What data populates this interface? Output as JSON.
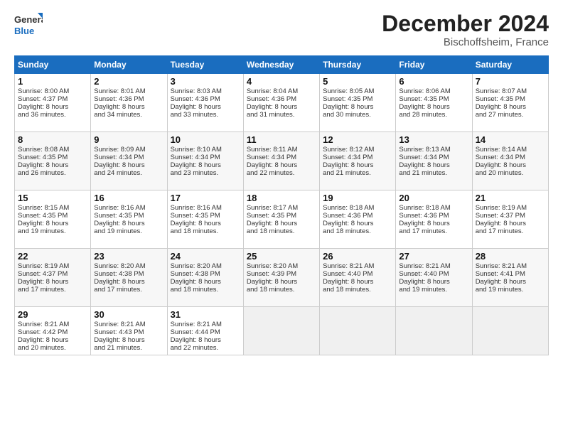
{
  "header": {
    "logo_line1": "General",
    "logo_line2": "Blue",
    "month": "December 2024",
    "location": "Bischoffsheim, France"
  },
  "days_of_week": [
    "Sunday",
    "Monday",
    "Tuesday",
    "Wednesday",
    "Thursday",
    "Friday",
    "Saturday"
  ],
  "weeks": [
    [
      {
        "day": "1",
        "lines": [
          "Sunrise: 8:00 AM",
          "Sunset: 4:37 PM",
          "Daylight: 8 hours",
          "and 36 minutes."
        ]
      },
      {
        "day": "2",
        "lines": [
          "Sunrise: 8:01 AM",
          "Sunset: 4:36 PM",
          "Daylight: 8 hours",
          "and 34 minutes."
        ]
      },
      {
        "day": "3",
        "lines": [
          "Sunrise: 8:03 AM",
          "Sunset: 4:36 PM",
          "Daylight: 8 hours",
          "and 33 minutes."
        ]
      },
      {
        "day": "4",
        "lines": [
          "Sunrise: 8:04 AM",
          "Sunset: 4:36 PM",
          "Daylight: 8 hours",
          "and 31 minutes."
        ]
      },
      {
        "day": "5",
        "lines": [
          "Sunrise: 8:05 AM",
          "Sunset: 4:35 PM",
          "Daylight: 8 hours",
          "and 30 minutes."
        ]
      },
      {
        "day": "6",
        "lines": [
          "Sunrise: 8:06 AM",
          "Sunset: 4:35 PM",
          "Daylight: 8 hours",
          "and 28 minutes."
        ]
      },
      {
        "day": "7",
        "lines": [
          "Sunrise: 8:07 AM",
          "Sunset: 4:35 PM",
          "Daylight: 8 hours",
          "and 27 minutes."
        ]
      }
    ],
    [
      {
        "day": "8",
        "lines": [
          "Sunrise: 8:08 AM",
          "Sunset: 4:35 PM",
          "Daylight: 8 hours",
          "and 26 minutes."
        ]
      },
      {
        "day": "9",
        "lines": [
          "Sunrise: 8:09 AM",
          "Sunset: 4:34 PM",
          "Daylight: 8 hours",
          "and 24 minutes."
        ]
      },
      {
        "day": "10",
        "lines": [
          "Sunrise: 8:10 AM",
          "Sunset: 4:34 PM",
          "Daylight: 8 hours",
          "and 23 minutes."
        ]
      },
      {
        "day": "11",
        "lines": [
          "Sunrise: 8:11 AM",
          "Sunset: 4:34 PM",
          "Daylight: 8 hours",
          "and 22 minutes."
        ]
      },
      {
        "day": "12",
        "lines": [
          "Sunrise: 8:12 AM",
          "Sunset: 4:34 PM",
          "Daylight: 8 hours",
          "and 21 minutes."
        ]
      },
      {
        "day": "13",
        "lines": [
          "Sunrise: 8:13 AM",
          "Sunset: 4:34 PM",
          "Daylight: 8 hours",
          "and 21 minutes."
        ]
      },
      {
        "day": "14",
        "lines": [
          "Sunrise: 8:14 AM",
          "Sunset: 4:34 PM",
          "Daylight: 8 hours",
          "and 20 minutes."
        ]
      }
    ],
    [
      {
        "day": "15",
        "lines": [
          "Sunrise: 8:15 AM",
          "Sunset: 4:35 PM",
          "Daylight: 8 hours",
          "and 19 minutes."
        ]
      },
      {
        "day": "16",
        "lines": [
          "Sunrise: 8:16 AM",
          "Sunset: 4:35 PM",
          "Daylight: 8 hours",
          "and 19 minutes."
        ]
      },
      {
        "day": "17",
        "lines": [
          "Sunrise: 8:16 AM",
          "Sunset: 4:35 PM",
          "Daylight: 8 hours",
          "and 18 minutes."
        ]
      },
      {
        "day": "18",
        "lines": [
          "Sunrise: 8:17 AM",
          "Sunset: 4:35 PM",
          "Daylight: 8 hours",
          "and 18 minutes."
        ]
      },
      {
        "day": "19",
        "lines": [
          "Sunrise: 8:18 AM",
          "Sunset: 4:36 PM",
          "Daylight: 8 hours",
          "and 18 minutes."
        ]
      },
      {
        "day": "20",
        "lines": [
          "Sunrise: 8:18 AM",
          "Sunset: 4:36 PM",
          "Daylight: 8 hours",
          "and 17 minutes."
        ]
      },
      {
        "day": "21",
        "lines": [
          "Sunrise: 8:19 AM",
          "Sunset: 4:37 PM",
          "Daylight: 8 hours",
          "and 17 minutes."
        ]
      }
    ],
    [
      {
        "day": "22",
        "lines": [
          "Sunrise: 8:19 AM",
          "Sunset: 4:37 PM",
          "Daylight: 8 hours",
          "and 17 minutes."
        ]
      },
      {
        "day": "23",
        "lines": [
          "Sunrise: 8:20 AM",
          "Sunset: 4:38 PM",
          "Daylight: 8 hours",
          "and 17 minutes."
        ]
      },
      {
        "day": "24",
        "lines": [
          "Sunrise: 8:20 AM",
          "Sunset: 4:38 PM",
          "Daylight: 8 hours",
          "and 18 minutes."
        ]
      },
      {
        "day": "25",
        "lines": [
          "Sunrise: 8:20 AM",
          "Sunset: 4:39 PM",
          "Daylight: 8 hours",
          "and 18 minutes."
        ]
      },
      {
        "day": "26",
        "lines": [
          "Sunrise: 8:21 AM",
          "Sunset: 4:40 PM",
          "Daylight: 8 hours",
          "and 18 minutes."
        ]
      },
      {
        "day": "27",
        "lines": [
          "Sunrise: 8:21 AM",
          "Sunset: 4:40 PM",
          "Daylight: 8 hours",
          "and 19 minutes."
        ]
      },
      {
        "day": "28",
        "lines": [
          "Sunrise: 8:21 AM",
          "Sunset: 4:41 PM",
          "Daylight: 8 hours",
          "and 19 minutes."
        ]
      }
    ],
    [
      {
        "day": "29",
        "lines": [
          "Sunrise: 8:21 AM",
          "Sunset: 4:42 PM",
          "Daylight: 8 hours",
          "and 20 minutes."
        ]
      },
      {
        "day": "30",
        "lines": [
          "Sunrise: 8:21 AM",
          "Sunset: 4:43 PM",
          "Daylight: 8 hours",
          "and 21 minutes."
        ]
      },
      {
        "day": "31",
        "lines": [
          "Sunrise: 8:21 AM",
          "Sunset: 4:44 PM",
          "Daylight: 8 hours",
          "and 22 minutes."
        ]
      },
      null,
      null,
      null,
      null
    ]
  ]
}
